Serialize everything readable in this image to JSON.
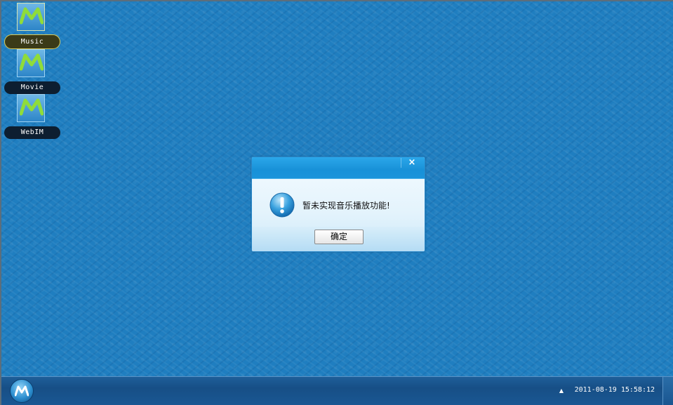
{
  "desktop": {
    "icons": [
      {
        "label": "Music",
        "icon": "app-logo-icon"
      },
      {
        "label": "Movie",
        "icon": "app-logo-icon"
      },
      {
        "label": "WebIM",
        "icon": "app-logo-icon"
      }
    ]
  },
  "dialog": {
    "message": "暂未实现音乐播放功能!",
    "ok_label": "确定",
    "close_glyph": "×",
    "icon": "info-icon"
  },
  "taskbar": {
    "tray_arrow": "▲",
    "clock": "2011-08-19 15:58:12",
    "start_icon": "start-logo-icon"
  },
  "colors": {
    "desktop_bg": "#1f7ec0",
    "dialog_title": "#1891d8",
    "taskbar": "#174f86",
    "icon_green": "#8fdc3a"
  }
}
